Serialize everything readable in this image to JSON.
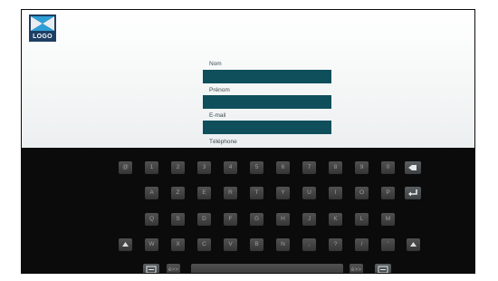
{
  "logo": {
    "text": "LOGO",
    "icon": "flag-logo-icon"
  },
  "form": {
    "fields": [
      {
        "label": "Nom",
        "value": ""
      },
      {
        "label": "Prénom",
        "value": ""
      },
      {
        "label": "E-mail",
        "value": ""
      },
      {
        "label": "Téléphone",
        "value": ""
      }
    ]
  },
  "keyboard": {
    "row1": [
      "@",
      "1",
      "2",
      "3",
      "4",
      "5",
      "6",
      "7",
      "8",
      "9",
      "0"
    ],
    "backspace_icon": "backspace-icon",
    "row2": [
      "A",
      "Z",
      "E",
      "R",
      "T",
      "Y",
      "U",
      "I",
      "O",
      "P"
    ],
    "enter_icon": "enter-icon",
    "row3": [
      "Q",
      "S",
      "D",
      "F",
      "G",
      "H",
      "J",
      "K",
      "L",
      "M"
    ],
    "row4": [
      "W",
      "X",
      "C",
      "V",
      "B",
      "N",
      ",",
      "?",
      "/",
      "'"
    ],
    "shift_icon": "shift-icon",
    "bottom": {
      "left_mode": "è>>",
      "right_mode": "è>>",
      "space": "",
      "hide_icon": "keyboard-hide-icon"
    }
  },
  "colors": {
    "input_fill": "#0f4f5c",
    "form_bg": "#f3f5f5",
    "keyboard_bg": "#0b0b0b",
    "key": "#454545"
  }
}
